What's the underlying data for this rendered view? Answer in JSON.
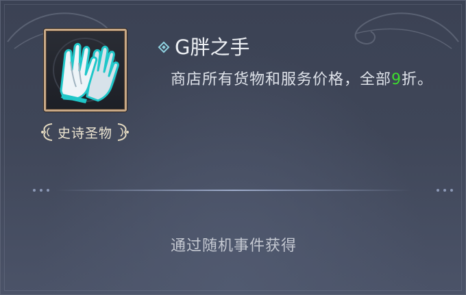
{
  "relic": {
    "icon": "white-gloves-icon",
    "rarity_label": "史诗圣物",
    "name": "G胖之手",
    "description_before": "商店所有货物和服务价格，全部",
    "description_highlight": "9",
    "description_after": "折。",
    "source_text": "通过随机事件获得"
  },
  "colors": {
    "frame_border": "#c8a987",
    "highlight": "#3ddc2e",
    "glove_trim": "#1fc7c9",
    "background": "#3f4658"
  }
}
